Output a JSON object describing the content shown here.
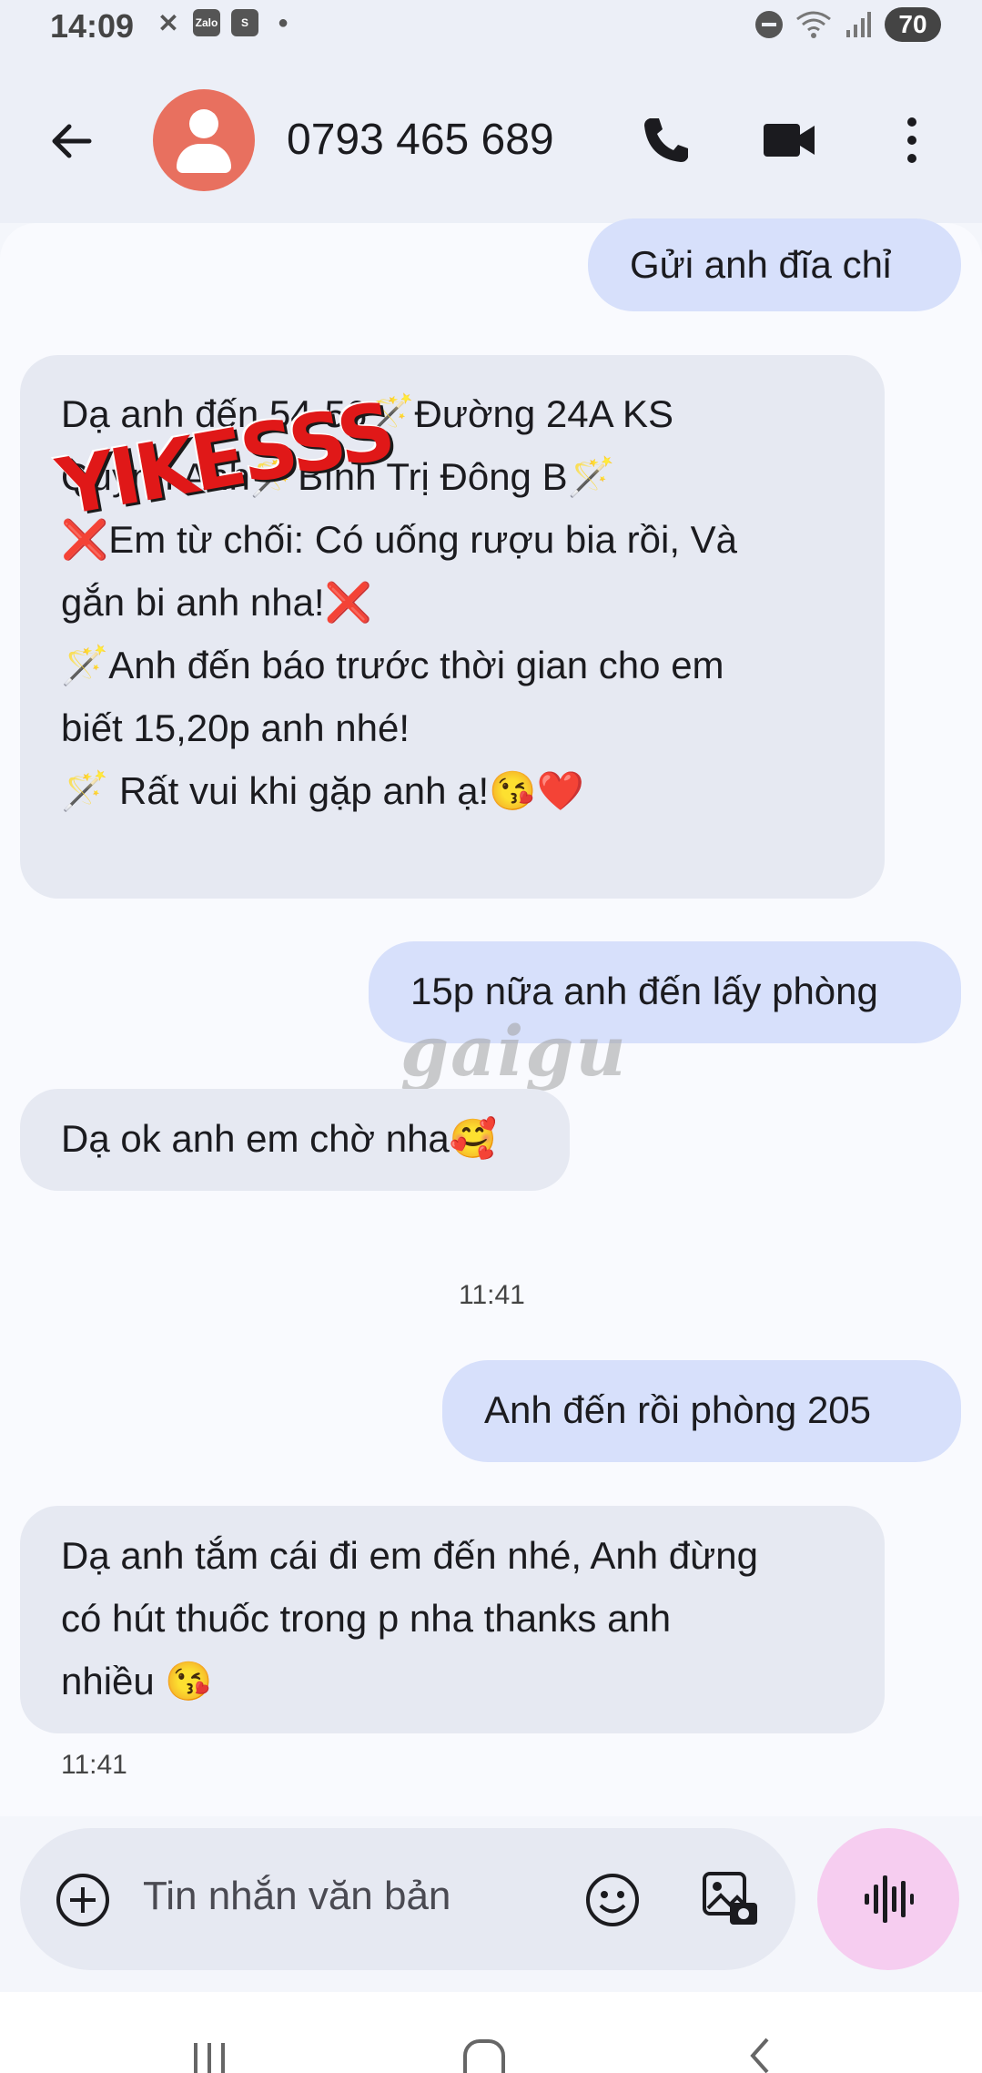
{
  "status_bar": {
    "time": "14:09",
    "app_icons": [
      "Zalo",
      "S"
    ],
    "battery": "70"
  },
  "header": {
    "contact": "0793 465 689",
    "icons": [
      "back-arrow-icon",
      "avatar",
      "phone-icon",
      "video-call-icon",
      "more-vert-icon"
    ]
  },
  "messages": [
    {
      "dir": "out",
      "lines": [
        "Gửi anh đĩa chỉ"
      ]
    },
    {
      "dir": "in",
      "lines": [
        "Dạ anh đến 54-56🪄Đường 24A KS",
        "Quỳnh Anh🪄Bình Trị Đông B🪄",
        "❌Em từ chối: Có uống rượu bia rồi, Và",
        "gắn bi anh nha!❌",
        "🪄Anh đến báo trước thời gian cho em",
        "biết 15,20p anh nhé!",
        "🪄 Rất vui khi gặp anh ạ!😘❤️"
      ]
    },
    {
      "dir": "out",
      "lines": [
        "15p nữa anh đến lấy phòng"
      ]
    },
    {
      "dir": "in",
      "lines": [
        "Dạ ok anh em chờ nha🥰"
      ]
    },
    {
      "dir": "out",
      "lines": [
        "Anh đến rồi phòng 205"
      ]
    },
    {
      "dir": "in",
      "lines": [
        "Dạ anh tắm cái đi em đến nhé, Anh đừng",
        "có hút thuốc trong p nha thanks anh",
        "nhiều 😘"
      ]
    }
  ],
  "timestamps": [
    "11:41",
    "11:41"
  ],
  "overlays": {
    "sticker": "YIKESSS",
    "watermark": "gaigu"
  },
  "composer": {
    "placeholder": "Tin nhắn văn bản"
  },
  "colors": {
    "outgoing_bubble": "#d7e0fb",
    "incoming_bubble": "#e6e9f2",
    "avatar": "#e8705f",
    "mic_button": "#f6cdf0"
  }
}
